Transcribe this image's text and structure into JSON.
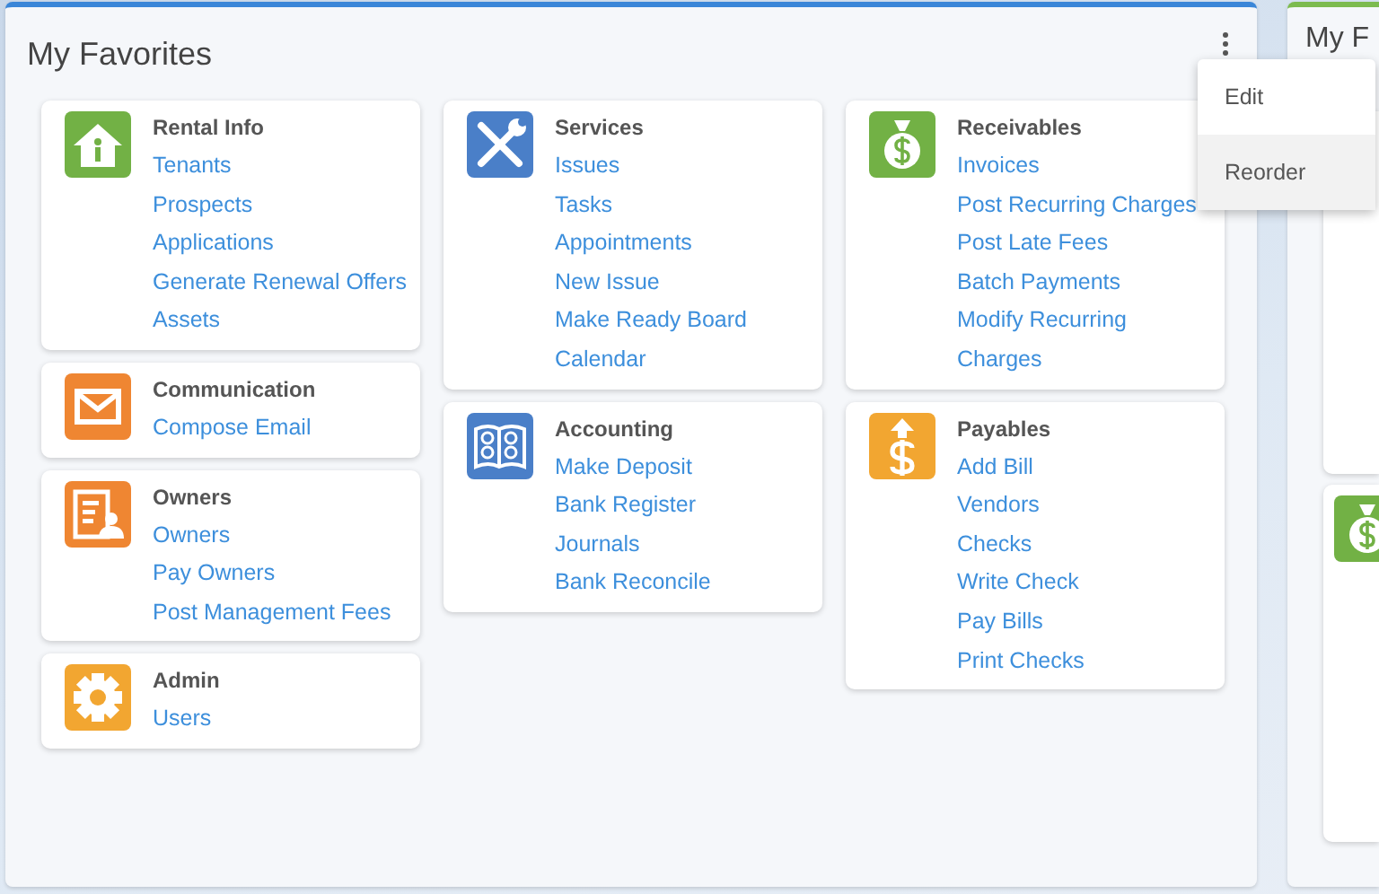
{
  "panel": {
    "title": "My Favorites",
    "columns": [
      [
        {
          "kind": "rental",
          "color": "#72b145",
          "title": "Rental Info",
          "links": [
            "Tenants",
            "Prospects",
            "Applications",
            "Generate Renewal Offers",
            "Assets"
          ]
        },
        {
          "kind": "mail",
          "color": "#ef8632",
          "title": "Communication",
          "links": [
            "Compose Email"
          ]
        },
        {
          "kind": "owners",
          "color": "#ef8632",
          "title": "Owners",
          "links": [
            "Owners",
            "Pay Owners",
            "Post Management Fees"
          ]
        },
        {
          "kind": "admin",
          "color": "#f2a631",
          "title": "Admin",
          "links": [
            "Users"
          ]
        }
      ],
      [
        {
          "kind": "services",
          "color": "#4a7fc8",
          "title": "Services",
          "links": [
            "Issues",
            "Tasks",
            "Appointments",
            "New Issue",
            "Make Ready Board",
            "Calendar"
          ]
        },
        {
          "kind": "accounting",
          "color": "#4a7fc8",
          "title": "Accounting",
          "links": [
            "Make Deposit",
            "Bank Register",
            "Journals",
            "Bank Reconcile"
          ]
        }
      ],
      [
        {
          "kind": "receivables",
          "color": "#72b145",
          "title": "Receivables",
          "links": [
            "Invoices",
            "Post Recurring Charges",
            "Post Late Fees",
            "Batch Payments",
            "Modify Recurring Charges"
          ]
        },
        {
          "kind": "payables",
          "color": "#f2a631",
          "title": "Payables",
          "links": [
            "Add Bill",
            "Vendors",
            "Checks",
            "Write Check",
            "Pay Bills",
            "Print Checks"
          ]
        }
      ]
    ]
  },
  "menu": [
    {
      "label": "Edit",
      "highlighted": false
    },
    {
      "label": "Reorder",
      "highlighted": true
    }
  ],
  "side_panel": {
    "title": "My F"
  }
}
